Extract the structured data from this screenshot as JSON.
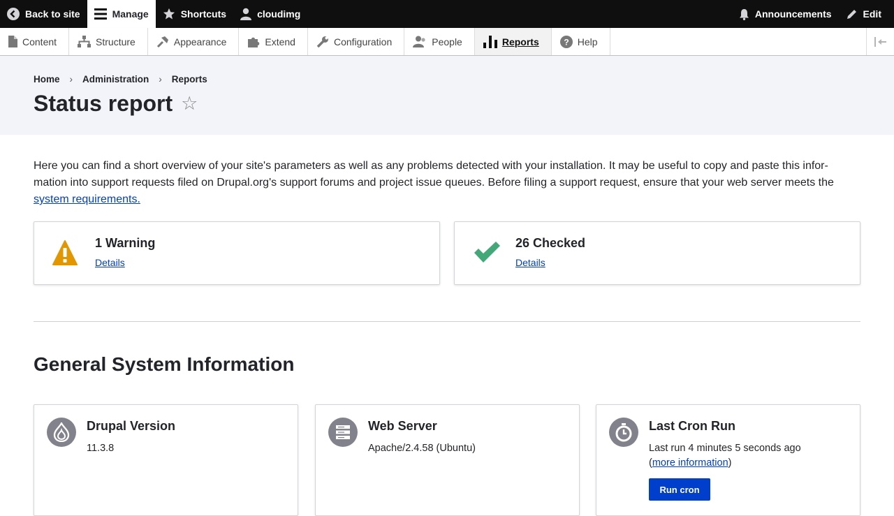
{
  "toolbar": {
    "back_label": "Back to site",
    "manage_label": "Manage",
    "shortcuts_label": "Shortcuts",
    "user_label": "cloudimg",
    "announcements_label": "Announcements",
    "edit_label": "Edit"
  },
  "tray": {
    "items": [
      {
        "label": "Content",
        "icon": "content-icon"
      },
      {
        "label": "Structure",
        "icon": "structure-icon"
      },
      {
        "label": "Appearance",
        "icon": "appearance-icon"
      },
      {
        "label": "Extend",
        "icon": "extend-icon"
      },
      {
        "label": "Configuration",
        "icon": "configuration-icon"
      },
      {
        "label": "People",
        "icon": "people-icon"
      },
      {
        "label": "Reports",
        "icon": "reports-icon",
        "active": true
      },
      {
        "label": "Help",
        "icon": "help-icon"
      }
    ]
  },
  "breadcrumb": {
    "items": [
      "Home",
      "Administration",
      "Reports"
    ],
    "separator": "›"
  },
  "page": {
    "title": "Status report",
    "star": "☆"
  },
  "intro": {
    "line1": "Here you can find a short overview of your site's parameters as well as any problems detected with your installation. It may be useful to copy and paste this infor-",
    "line2": "mation into support requests filed on Drupal.org's support forums and project issue queues. Before filing a support request, ensure that your web server meets the",
    "link": "system requirements."
  },
  "counters": {
    "warning": {
      "title": "1 Warning",
      "link": "Details",
      "color": "#e29700"
    },
    "checked": {
      "title": "26 Checked",
      "link": "Details",
      "color": "#42a877"
    }
  },
  "general": {
    "title": "General System Information",
    "drupal": {
      "title": "Drupal Version",
      "value": "11.3.8"
    },
    "webserver": {
      "title": "Web Server",
      "value": "Apache/2.4.58 (Ubuntu)"
    },
    "cron": {
      "title": "Last Cron Run",
      "value": "Last run 4 minutes 5 seconds ago",
      "paren_open": "(",
      "link": "more information",
      "paren_close": ")",
      "button": "Run cron"
    }
  },
  "colors": {
    "toolbar_bg": "#0f0f0f",
    "link": "#003ecc",
    "header_bg": "#f3f4f9"
  }
}
